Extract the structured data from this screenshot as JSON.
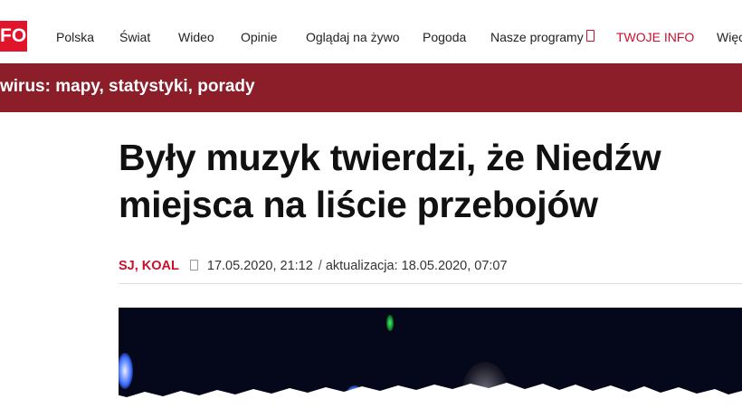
{
  "logo": {
    "text": "FO"
  },
  "nav": {
    "items": [
      "Polska",
      "Świat",
      "Wideo",
      "Opinie",
      "Oglądaj na żywo",
      "Pogoda",
      "Nasze programy",
      "TWOJE INFO",
      "Więc"
    ]
  },
  "banner": {
    "text": "wirus: mapy, statystyki, porady"
  },
  "article": {
    "headline_line1": "Były muzyk twierdzi, że Niedźw",
    "headline_line2": "miejsca na liście przebojów",
    "author": "SJ, KOAL",
    "published": "17.05.2020, 21:12",
    "separator": "/",
    "updated": "aktualizacja: 18.05.2020, 07:07"
  },
  "colors": {
    "brand_red": "#e0142b",
    "banner_bg": "#8b1e29",
    "link_red": "#c8102e"
  }
}
